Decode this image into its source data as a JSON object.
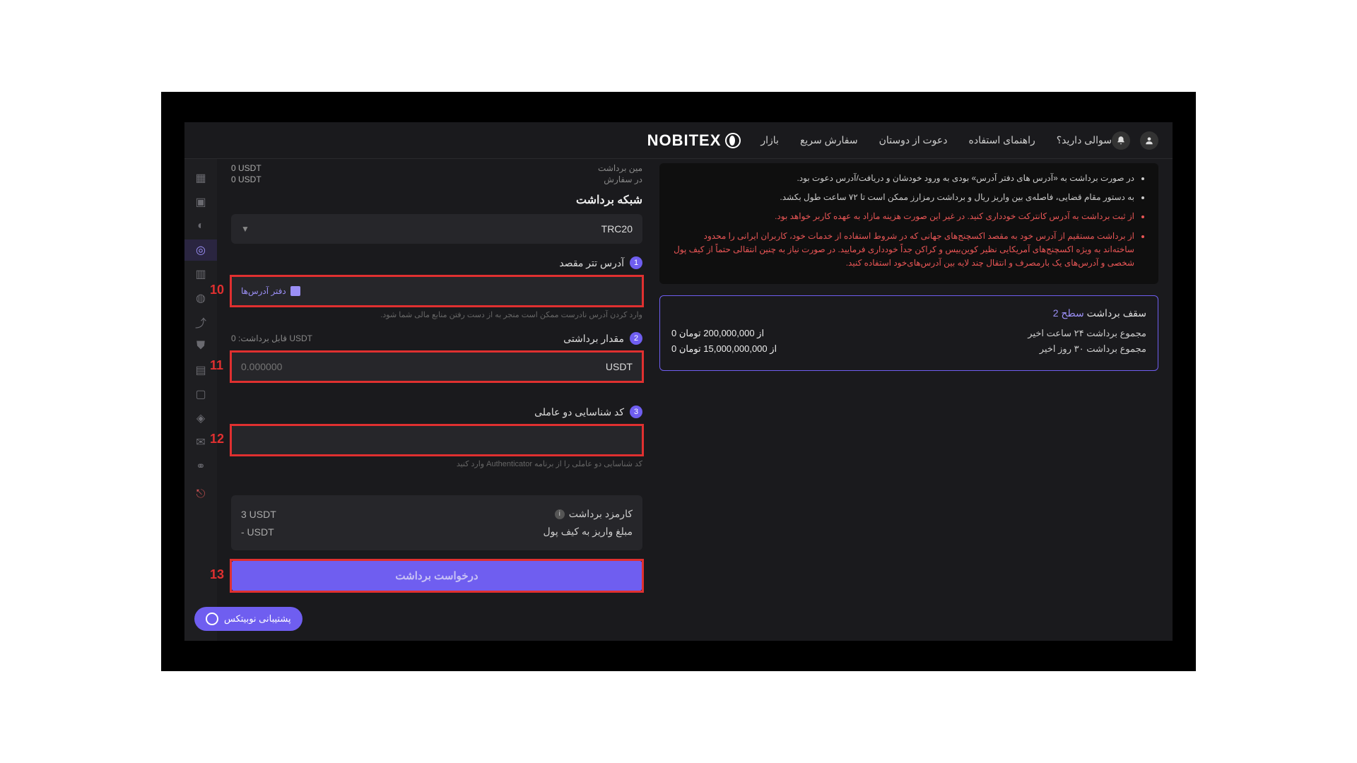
{
  "brand": "NOBITEX",
  "nav": {
    "market": "بازار",
    "quick_order": "سفارش سریع",
    "invite": "دعوت از دوستان",
    "guide": "راهنمای استفاده",
    "faq": "سوالی دارید؟"
  },
  "balances": {
    "min_label": "مین برداشت",
    "min_val": "0 USDT",
    "in_order_label": "در سفارش",
    "in_order_val": "0 USDT"
  },
  "network": {
    "title": "شبکه برداشت",
    "selected": "TRC20"
  },
  "step1": {
    "num": "1",
    "label": "آدرس تتر مقصد",
    "address_book": "دفتر آدرس‌ها",
    "helper": "وارد کردن آدرس نادرست ممکن است منجر به از دست رفتن منابع مالی شما شود."
  },
  "step2": {
    "num": "2",
    "label": "مقدار برداشتی",
    "withdrawable": "قابل برداشت:",
    "withdrawable_val": "0 USDT",
    "unit": "USDT",
    "placeholder": "0.000000"
  },
  "step3": {
    "num": "3",
    "label": "کد شناسایی دو عاملی",
    "helper": "کد شناسایی دو عاملی را از برنامه Authenticator وارد کنید"
  },
  "fee": {
    "label": "کارمزد برداشت",
    "val": "3  USDT",
    "net_label": "مبلغ واریز به کیف پول",
    "net_val": "-  USDT"
  },
  "submit": "درخواست برداشت",
  "warnings": {
    "w1": "در صورت برداشت به «آدرس های دفتر آدرس» بودی به ورود خودشان و دریافت/آدرس دعوت بود.",
    "w2": "به دستور مقام قضایی، فاصله‌ی بین واریز ریال و برداشت رمزارز ممکن است تا ۷۲ ساعت طول بکشد.",
    "w3": "از ثبت برداشت به آدرس کانترکت خودداری کنید. در غیر این صورت هزینه مازاد به عهده کاربر خواهد بود.",
    "w4": "از برداشت مستقیم از آدرس خود به مقصد اکسچنج‌های جهانی که در شروط استفاده از خدمات خود، کاربران ایرانی را محدود ساخته‌اند به ویژه اکسچنج‌های آمریکایی نظیر کوین‌بیس و کراکن جداً خودداری فرمایید. در صورت نیاز به چنین انتقالی حتماً از کیف پول شخصی و آدرس‌های یک بارمصرف و انتقال چند لایه بین آدرس‌های‌خود استفاده کنید."
  },
  "limit": {
    "title_prefix": "سقف برداشت",
    "level": "سطح 2",
    "row1_label": "مجموع برداشت ۲۴ ساعت اخیر",
    "row1_val": "0 از 200,000,000 تومان",
    "row2_label": "مجموع برداشت ۳۰ روز اخیر",
    "row2_val": "0 از 15,000,000,000 تومان"
  },
  "support": "پشتیبانی نوبیتکس",
  "annotations": {
    "a10": "10",
    "a11": "11",
    "a12": "12",
    "a13": "13"
  }
}
